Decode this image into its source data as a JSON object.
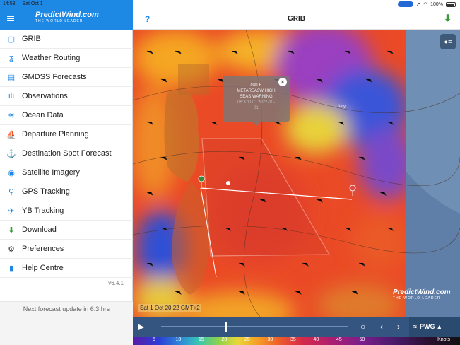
{
  "status_bar": {
    "time": "14:53",
    "date": "Sat Oct 1",
    "battery": "100%"
  },
  "sidebar": {
    "logo": {
      "brand": "PredictWind.com",
      "tagline": "THE WORLD LEADER"
    },
    "items": [
      {
        "label": "GRIB",
        "icon": "grib-icon"
      },
      {
        "label": "Weather Routing",
        "icon": "routing-icon"
      },
      {
        "label": "GMDSS Forecasts",
        "icon": "document-icon"
      },
      {
        "label": "Observations",
        "icon": "observations-icon"
      },
      {
        "label": "Ocean Data",
        "icon": "waves-icon"
      },
      {
        "label": "Departure Planning",
        "icon": "sailboat-icon"
      },
      {
        "label": "Destination Spot Forecast",
        "icon": "anchor-icon"
      },
      {
        "label": "Satellite Imagery",
        "icon": "camera-icon"
      },
      {
        "label": "GPS Tracking",
        "icon": "pin-icon"
      },
      {
        "label": "YB Tracking",
        "icon": "satellite-icon"
      },
      {
        "label": "Download",
        "icon": "download-icon"
      },
      {
        "label": "Preferences",
        "icon": "gear-icon"
      },
      {
        "label": "Help Centre",
        "icon": "book-icon"
      }
    ],
    "version": "v6.4.1",
    "forecast_note": "Next forecast update in 6.3 hrs"
  },
  "header": {
    "help": "?",
    "title": "GRIB"
  },
  "map": {
    "popup": {
      "line1": "GALE",
      "line2": "METAREA3W HIGH",
      "line3": "SEAS WARNING",
      "line4": "06:37UTC 2022-10-",
      "line5": "01",
      "close": "×"
    },
    "city_label": "Italy",
    "brand": "PredictWind.com",
    "tagline": "THE WORLD LEADER",
    "time_label": "Sat 1 Oct 20:22 GMT+2",
    "timeline_position": 0.34,
    "model_button": "PWG",
    "scale": {
      "ticks": [
        "5",
        "10",
        "15",
        "20",
        "25",
        "30",
        "35",
        "40",
        "45",
        "50"
      ],
      "unit": "Knots"
    }
  },
  "colors": {
    "accent": "#1e88e5",
    "controls_bar": "#33557f"
  }
}
